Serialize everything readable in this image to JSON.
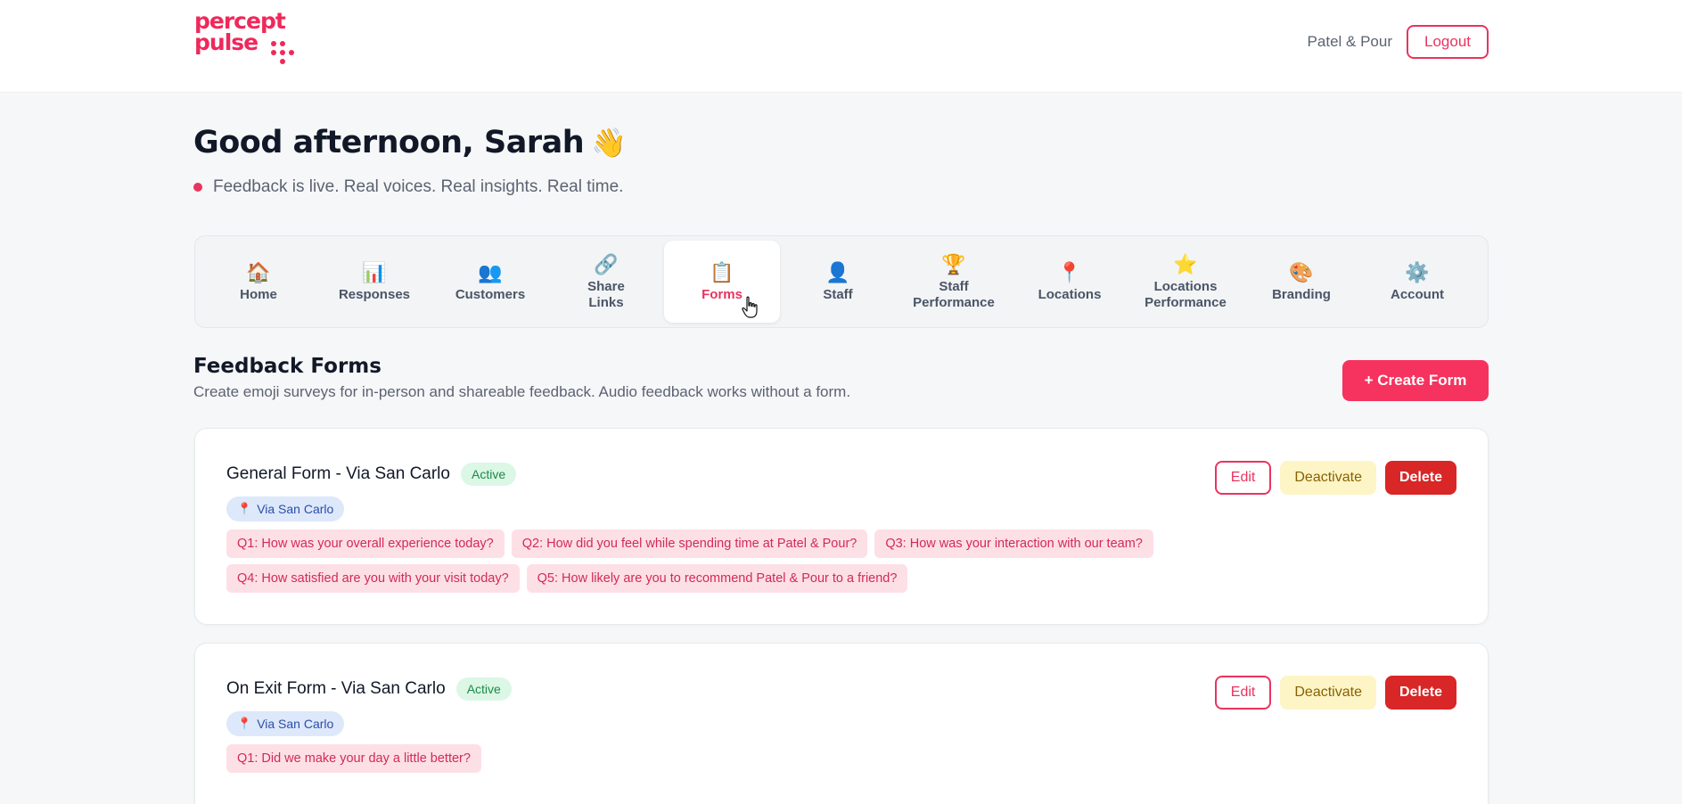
{
  "header": {
    "logo_line1": "percept",
    "logo_line2": "pulse",
    "business_name": "Patel & Pour",
    "logout_label": "Logout"
  },
  "greeting": {
    "title": "Good afternoon, Sarah",
    "emoji": "👋",
    "tagline": "Feedback is live. Real voices. Real insights. Real time."
  },
  "nav": {
    "items": [
      {
        "label": "Home",
        "icon": "house-icon",
        "glyph": "🏠"
      },
      {
        "label": "Responses",
        "icon": "bar-chart-icon",
        "glyph": "📊"
      },
      {
        "label": "Customers",
        "icon": "users-icon",
        "glyph": "👥"
      },
      {
        "label": "Share\nLinks",
        "icon": "link-icon",
        "glyph": "🔗"
      },
      {
        "label": "Forms",
        "icon": "clipboard-icon",
        "glyph": "📋",
        "active": true
      },
      {
        "label": "Staff",
        "icon": "person-icon",
        "glyph": "👤"
      },
      {
        "label": "Staff\nPerformance",
        "icon": "trophy-icon",
        "glyph": "🏆"
      },
      {
        "label": "Locations",
        "icon": "pin-icon",
        "glyph": "📍"
      },
      {
        "label": "Locations\nPerformance",
        "icon": "star-icon",
        "glyph": "⭐"
      },
      {
        "label": "Branding",
        "icon": "palette-icon",
        "glyph": "🎨"
      },
      {
        "label": "Account",
        "icon": "gear-icon",
        "glyph": "⚙️"
      }
    ]
  },
  "section": {
    "title": "Feedback Forms",
    "subtitle": "Create emoji surveys for in-person and shareable feedback. Audio feedback works without a form.",
    "create_label": "+ Create Form"
  },
  "forms": [
    {
      "title": "General Form - Via San Carlo",
      "status": "Active",
      "location": "Via San Carlo",
      "questions_row1": [
        "Q1: How was your overall experience today?",
        "Q2: How did you feel while spending time at Patel & Pour?",
        "Q3: How was your interaction with our team?"
      ],
      "questions_row2": [
        "Q4: How satisfied are you with your visit today?",
        "Q5: How likely are you to recommend Patel & Pour to a friend?"
      ],
      "edit_label": "Edit",
      "deactivate_label": "Deactivate",
      "delete_label": "Delete"
    },
    {
      "title": "On Exit Form - Via San Carlo",
      "status": "Active",
      "location": "Via San Carlo",
      "questions_row1": [
        "Q1: Did we make your day a little better?"
      ],
      "edit_label": "Edit",
      "deactivate_label": "Deactivate",
      "delete_label": "Delete"
    }
  ],
  "colors": {
    "brand": "#f0285a",
    "active_badge_bg": "#dcf7e6",
    "delete": "#d92626",
    "deactivate_bg": "#fdf5c6"
  }
}
